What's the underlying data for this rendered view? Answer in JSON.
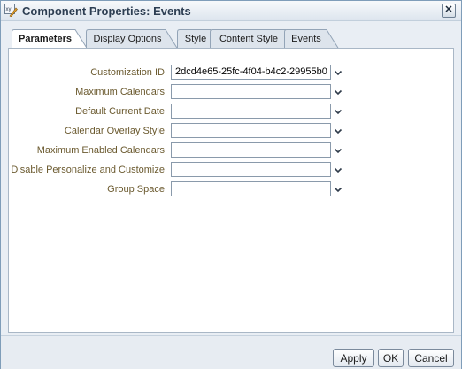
{
  "window": {
    "title": "Component Properties: Events",
    "icon": "component-properties-icon",
    "close_label": "✕"
  },
  "tabs": [
    {
      "label": "Parameters",
      "active": true
    },
    {
      "label": "Display Options",
      "active": false
    },
    {
      "label": "Style",
      "active": false
    },
    {
      "label": "Content Style",
      "active": false
    },
    {
      "label": "Events",
      "active": false
    }
  ],
  "fields": [
    {
      "label": "Customization ID",
      "value": "2dcd4e65-25fc-4f04-b4c2-29955b0"
    },
    {
      "label": "Maximum Calendars",
      "value": ""
    },
    {
      "label": "Default Current Date",
      "value": ""
    },
    {
      "label": "Calendar Overlay Style",
      "value": ""
    },
    {
      "label": "Maximum Enabled Calendars",
      "value": ""
    },
    {
      "label": "Disable Personalize and Customize",
      "value": ""
    },
    {
      "label": "Group Space",
      "value": ""
    }
  ],
  "buttons": {
    "apply": "Apply",
    "ok": "OK",
    "cancel": "Cancel"
  },
  "colors": {
    "label_text": "#6b5a2f",
    "panel_background": "#ffffff",
    "dialog_background": "#e9eef4"
  }
}
